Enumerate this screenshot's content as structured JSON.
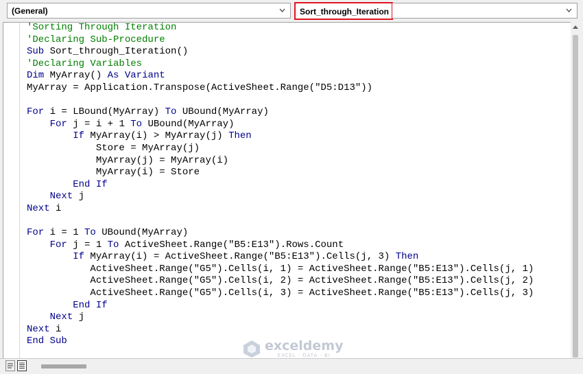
{
  "object_dropdown": {
    "value": "(General)"
  },
  "procedure_dropdown": {
    "value": "Sort_through_Iteration",
    "highlight_color": "#e0141e"
  },
  "code": {
    "lines": [
      {
        "indent": "",
        "parts": [
          {
            "t": "'Sorting Through Iteration",
            "c": "cm"
          }
        ]
      },
      {
        "indent": "",
        "parts": [
          {
            "t": "'Declaring Sub-Procedure",
            "c": "cm"
          }
        ]
      },
      {
        "indent": "",
        "parts": [
          {
            "t": "Sub",
            "c": "kw"
          },
          {
            "t": " Sort_through_Iteration()"
          }
        ]
      },
      {
        "indent": "",
        "parts": [
          {
            "t": "'Declaring Variables",
            "c": "cm"
          }
        ]
      },
      {
        "indent": "",
        "parts": [
          {
            "t": "Dim",
            "c": "kw"
          },
          {
            "t": " MyArray() "
          },
          {
            "t": "As",
            "c": "kw"
          },
          {
            "t": " "
          },
          {
            "t": "Variant",
            "c": "kw"
          }
        ]
      },
      {
        "indent": "",
        "parts": [
          {
            "t": "MyArray = Application.Transpose(ActiveSheet.Range(\"D5:D13\"))"
          }
        ]
      },
      {
        "indent": "",
        "parts": []
      },
      {
        "indent": "",
        "parts": [
          {
            "t": "For",
            "c": "kw"
          },
          {
            "t": " i = LBound(MyArray) "
          },
          {
            "t": "To",
            "c": "kw"
          },
          {
            "t": " UBound(MyArray)"
          }
        ]
      },
      {
        "indent": "    ",
        "parts": [
          {
            "t": "For",
            "c": "kw"
          },
          {
            "t": " j = i + 1 "
          },
          {
            "t": "To",
            "c": "kw"
          },
          {
            "t": " UBound(MyArray)"
          }
        ]
      },
      {
        "indent": "        ",
        "parts": [
          {
            "t": "If",
            "c": "kw"
          },
          {
            "t": " MyArray(i) > MyArray(j) "
          },
          {
            "t": "Then",
            "c": "kw"
          }
        ]
      },
      {
        "indent": "            ",
        "parts": [
          {
            "t": "Store = MyArray(j)"
          }
        ]
      },
      {
        "indent": "            ",
        "parts": [
          {
            "t": "MyArray(j) = MyArray(i)"
          }
        ]
      },
      {
        "indent": "            ",
        "parts": [
          {
            "t": "MyArray(i) = Store"
          }
        ]
      },
      {
        "indent": "        ",
        "parts": [
          {
            "t": "End If",
            "c": "kw"
          }
        ]
      },
      {
        "indent": "    ",
        "parts": [
          {
            "t": "Next",
            "c": "kw"
          },
          {
            "t": " j"
          }
        ]
      },
      {
        "indent": "",
        "parts": [
          {
            "t": "Next",
            "c": "kw"
          },
          {
            "t": " i"
          }
        ]
      },
      {
        "indent": "",
        "parts": []
      },
      {
        "indent": "",
        "parts": [
          {
            "t": "For",
            "c": "kw"
          },
          {
            "t": " i = 1 "
          },
          {
            "t": "To",
            "c": "kw"
          },
          {
            "t": " UBound(MyArray)"
          }
        ]
      },
      {
        "indent": "    ",
        "parts": [
          {
            "t": "For",
            "c": "kw"
          },
          {
            "t": " j = 1 "
          },
          {
            "t": "To",
            "c": "kw"
          },
          {
            "t": " ActiveSheet.Range(\"B5:E13\").Rows.Count"
          }
        ]
      },
      {
        "indent": "        ",
        "parts": [
          {
            "t": "If",
            "c": "kw"
          },
          {
            "t": " MyArray(i) = ActiveSheet.Range(\"B5:E13\").Cells(j, 3) "
          },
          {
            "t": "Then",
            "c": "kw"
          }
        ]
      },
      {
        "indent": "           ",
        "parts": [
          {
            "t": "ActiveSheet.Range(\"G5\").Cells(i, 1) = ActiveSheet.Range(\"B5:E13\").Cells(j, 1)"
          }
        ]
      },
      {
        "indent": "           ",
        "parts": [
          {
            "t": "ActiveSheet.Range(\"G5\").Cells(i, 2) = ActiveSheet.Range(\"B5:E13\").Cells(j, 2)"
          }
        ]
      },
      {
        "indent": "           ",
        "parts": [
          {
            "t": "ActiveSheet.Range(\"G5\").Cells(i, 3) = ActiveSheet.Range(\"B5:E13\").Cells(j, 3)"
          }
        ]
      },
      {
        "indent": "        ",
        "parts": [
          {
            "t": "End If",
            "c": "kw"
          }
        ]
      },
      {
        "indent": "    ",
        "parts": [
          {
            "t": "Next",
            "c": "kw"
          },
          {
            "t": " j"
          }
        ]
      },
      {
        "indent": "",
        "parts": [
          {
            "t": "Next",
            "c": "kw"
          },
          {
            "t": " i"
          }
        ]
      },
      {
        "indent": "",
        "parts": [
          {
            "t": "End Sub",
            "c": "kw"
          }
        ]
      }
    ],
    "keyword_color": "#00008b",
    "comment_color": "#008000"
  },
  "watermark": {
    "name": "exceldemy",
    "tagline": "EXCEL · DATA · BI"
  },
  "icons": {
    "object_dropdown_arrow": "chevron-down-icon",
    "procedure_dropdown_arrow": "chevron-down-icon",
    "procedure_view": "procedure-view-icon",
    "full_module_view": "full-module-view-icon",
    "scroll_up": "scroll-up-arrow-icon",
    "watermark_logo": "exceldemy-logo-icon"
  }
}
